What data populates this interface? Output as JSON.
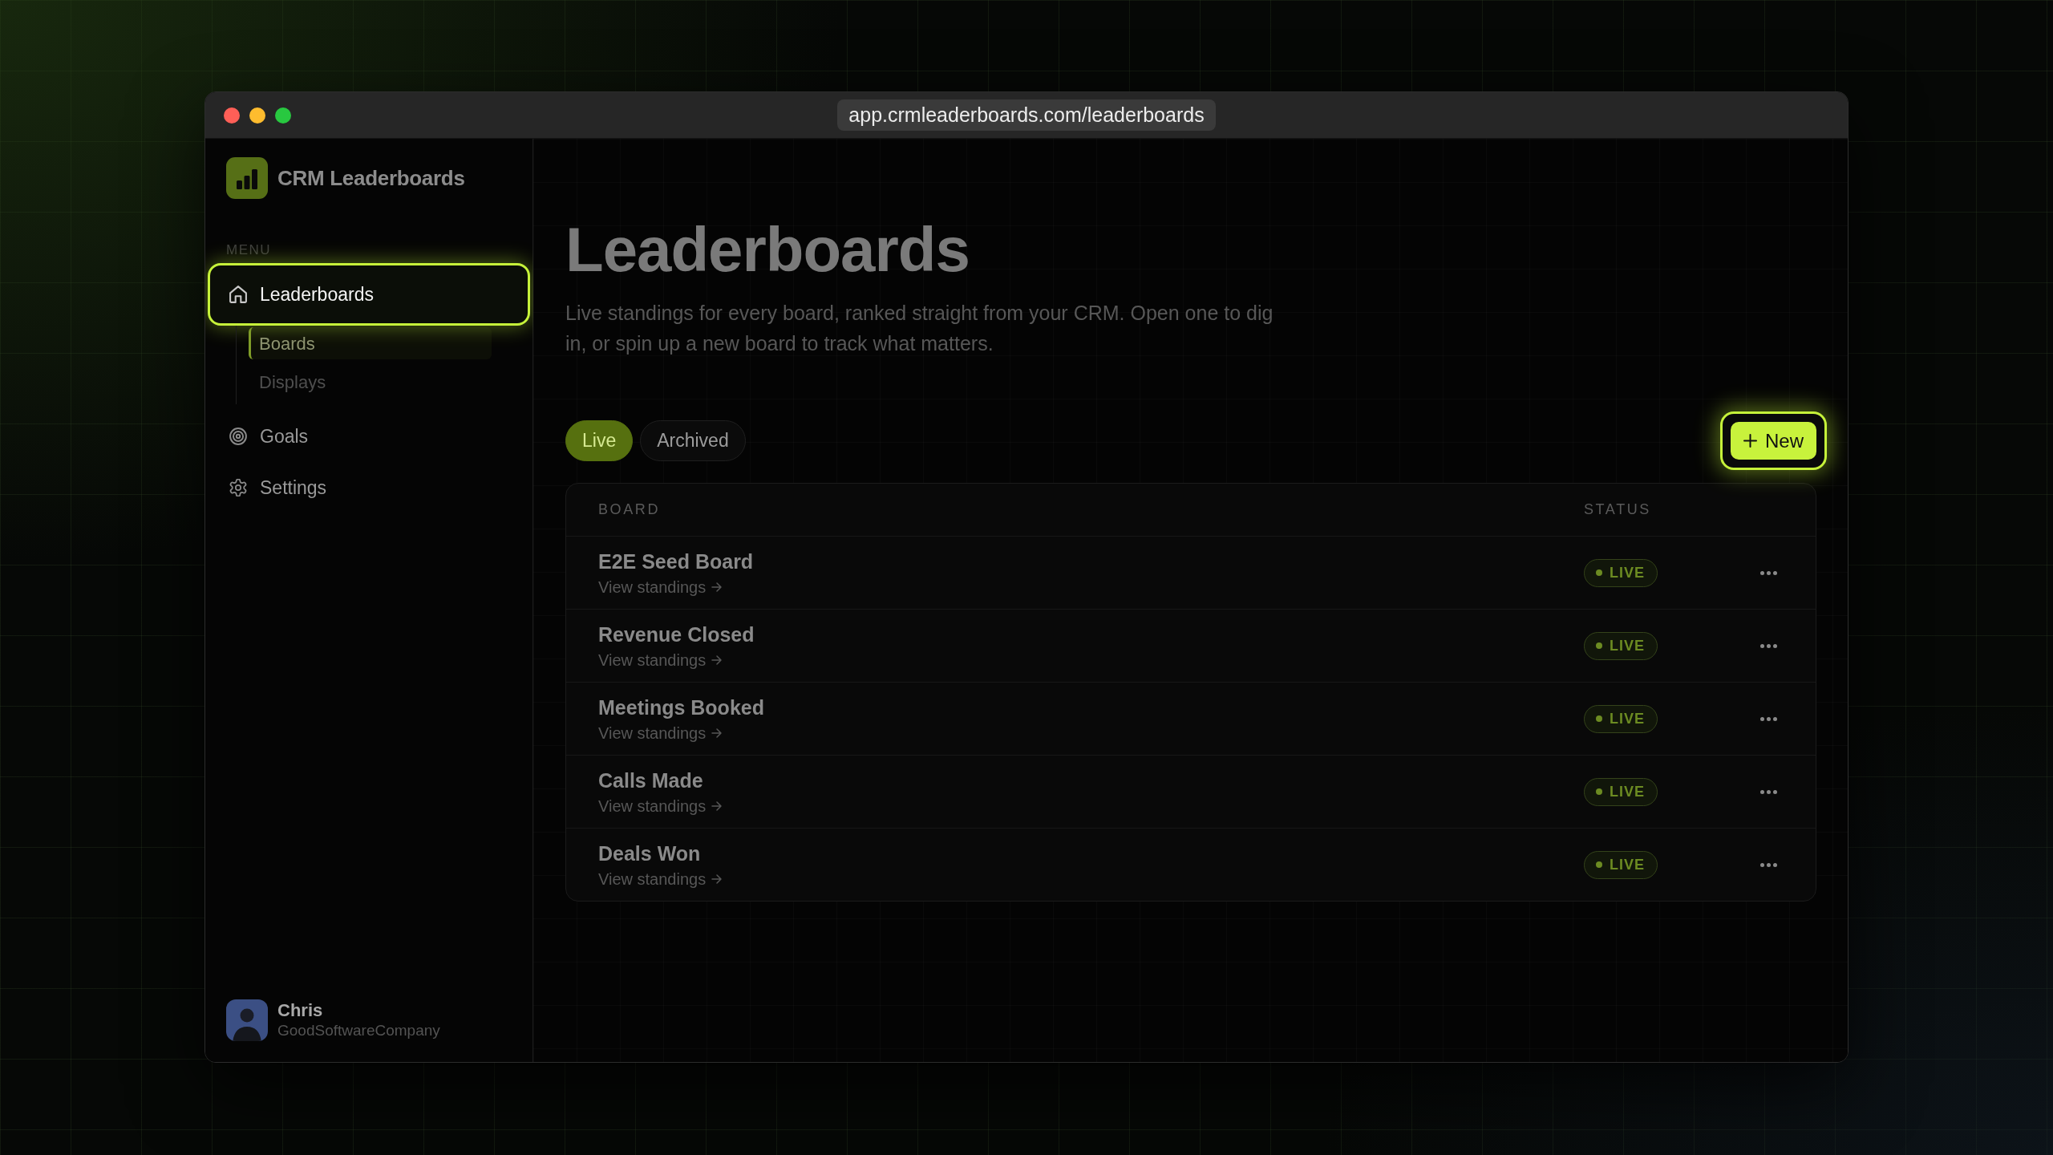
{
  "window": {
    "url": "app.crmleaderboards.com/leaderboards"
  },
  "sidebar": {
    "brand": "CRM Leaderboards",
    "section_label": "MENU",
    "items": [
      {
        "label": "Leaderboards",
        "selected": true,
        "children": [
          {
            "label": "Boards",
            "selected": true
          },
          {
            "label": "Displays",
            "selected": false
          }
        ]
      },
      {
        "label": "Goals",
        "selected": false
      },
      {
        "label": "Settings",
        "selected": false
      }
    ],
    "user": {
      "name": "Chris",
      "company": "GoodSoftwareCompany"
    }
  },
  "page": {
    "title": "Leaderboards",
    "description": "Live standings for every board, ranked straight from your CRM. Open one to dig in, or spin up a new board to track what matters."
  },
  "filter_tabs": [
    {
      "label": "Live",
      "selected": true
    },
    {
      "label": "Archived",
      "selected": false
    }
  ],
  "new_button": {
    "label": "New"
  },
  "table": {
    "columns": [
      "BOARD",
      "STATUS"
    ],
    "rows": [
      {
        "name": "E2E Seed Board",
        "link": "View standings",
        "status": "LIVE"
      },
      {
        "name": "Revenue Closed",
        "link": "View standings",
        "status": "LIVE"
      },
      {
        "name": "Meetings Booked",
        "link": "View standings",
        "status": "LIVE"
      },
      {
        "name": "Calls Made",
        "link": "View standings",
        "status": "LIVE"
      },
      {
        "name": "Deals Won",
        "link": "View standings",
        "status": "LIVE"
      }
    ]
  }
}
